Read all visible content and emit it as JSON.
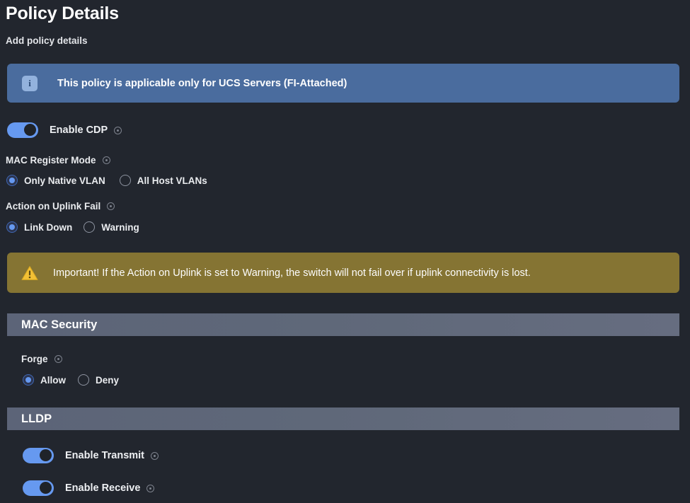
{
  "header": {
    "title": "Policy Details",
    "subtitle": "Add policy details"
  },
  "info_banner": {
    "icon": "info-icon",
    "icon_glyph": "i",
    "text": "This policy is applicable only for UCS Servers (FI-Attached)",
    "color": "#4a6c9e"
  },
  "warning_banner": {
    "icon": "warning-triangle-icon",
    "text": "Important! If the Action on Uplink is set to Warning, the switch will not fail over if uplink connectivity is lost.",
    "color": "#857433"
  },
  "cdp": {
    "toggle_label": "Enable CDP",
    "enabled": true,
    "hint": "info-hint-icon"
  },
  "mac_register_mode": {
    "label": "MAC Register Mode",
    "hint": "info-hint-icon",
    "options": [
      {
        "label": "Only Native VLAN",
        "checked": true
      },
      {
        "label": "All Host VLANs",
        "checked": false
      }
    ]
  },
  "action_on_uplink_fail": {
    "label": "Action on Uplink Fail",
    "hint": "info-hint-icon",
    "options": [
      {
        "label": "Link Down",
        "checked": true
      },
      {
        "label": "Warning",
        "checked": false
      }
    ]
  },
  "mac_security": {
    "section_title": "MAC Security",
    "forge": {
      "label": "Forge",
      "hint": "info-hint-icon",
      "options": [
        {
          "label": "Allow",
          "checked": true
        },
        {
          "label": "Deny",
          "checked": false
        }
      ]
    }
  },
  "lldp": {
    "section_title": "LLDP",
    "toggles": [
      {
        "label": "Enable Transmit",
        "enabled": true,
        "hint": "info-hint-icon"
      },
      {
        "label": "Enable Receive",
        "enabled": true,
        "hint": "info-hint-icon"
      }
    ]
  },
  "theme": {
    "background": "#22262e",
    "accent_blue": "#6699f0",
    "section_header": "#5f6879"
  }
}
